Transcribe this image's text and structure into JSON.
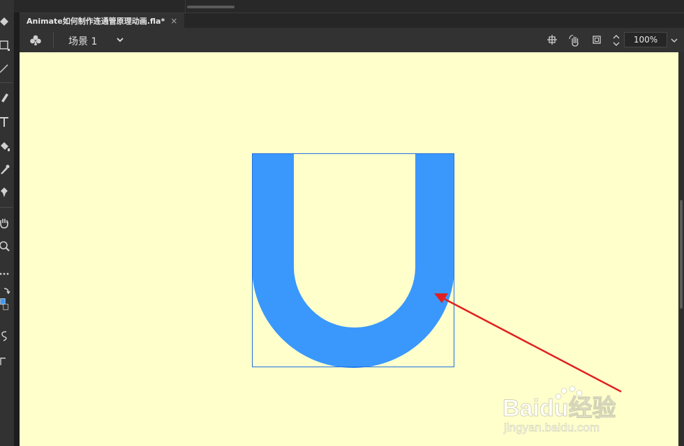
{
  "document_tab": {
    "title": "Animate如何制作连通管原理动画.fla*",
    "close_glyph": "×"
  },
  "edit_bar": {
    "scene_label": "场景 1",
    "zoom_value": "100%"
  },
  "stage": {
    "background_color": "#ffffcc",
    "shape_color": "#3a98fc",
    "arrow_color": "#e02020"
  },
  "watermark": {
    "brand": "Baidu经验",
    "url": "jingyan.baidu.com"
  },
  "icons": {
    "tools": [
      "subselection-icon",
      "rectangle-icon",
      "line-icon",
      "pen-icon",
      "text-icon",
      "paint-bucket-icon",
      "eyedropper-icon",
      "pin-icon",
      "hand-icon",
      "zoom-icon",
      "more-tools-icon",
      "swap-colors-icon",
      "fill-color-swatch",
      "lasso-icon",
      "corner-icon"
    ],
    "edit_bar": [
      "scene-icon",
      "center-stage-icon",
      "rotate-stage-icon",
      "clip-content-icon",
      "zoom-stepper-icon",
      "chevron-down-icon"
    ]
  }
}
